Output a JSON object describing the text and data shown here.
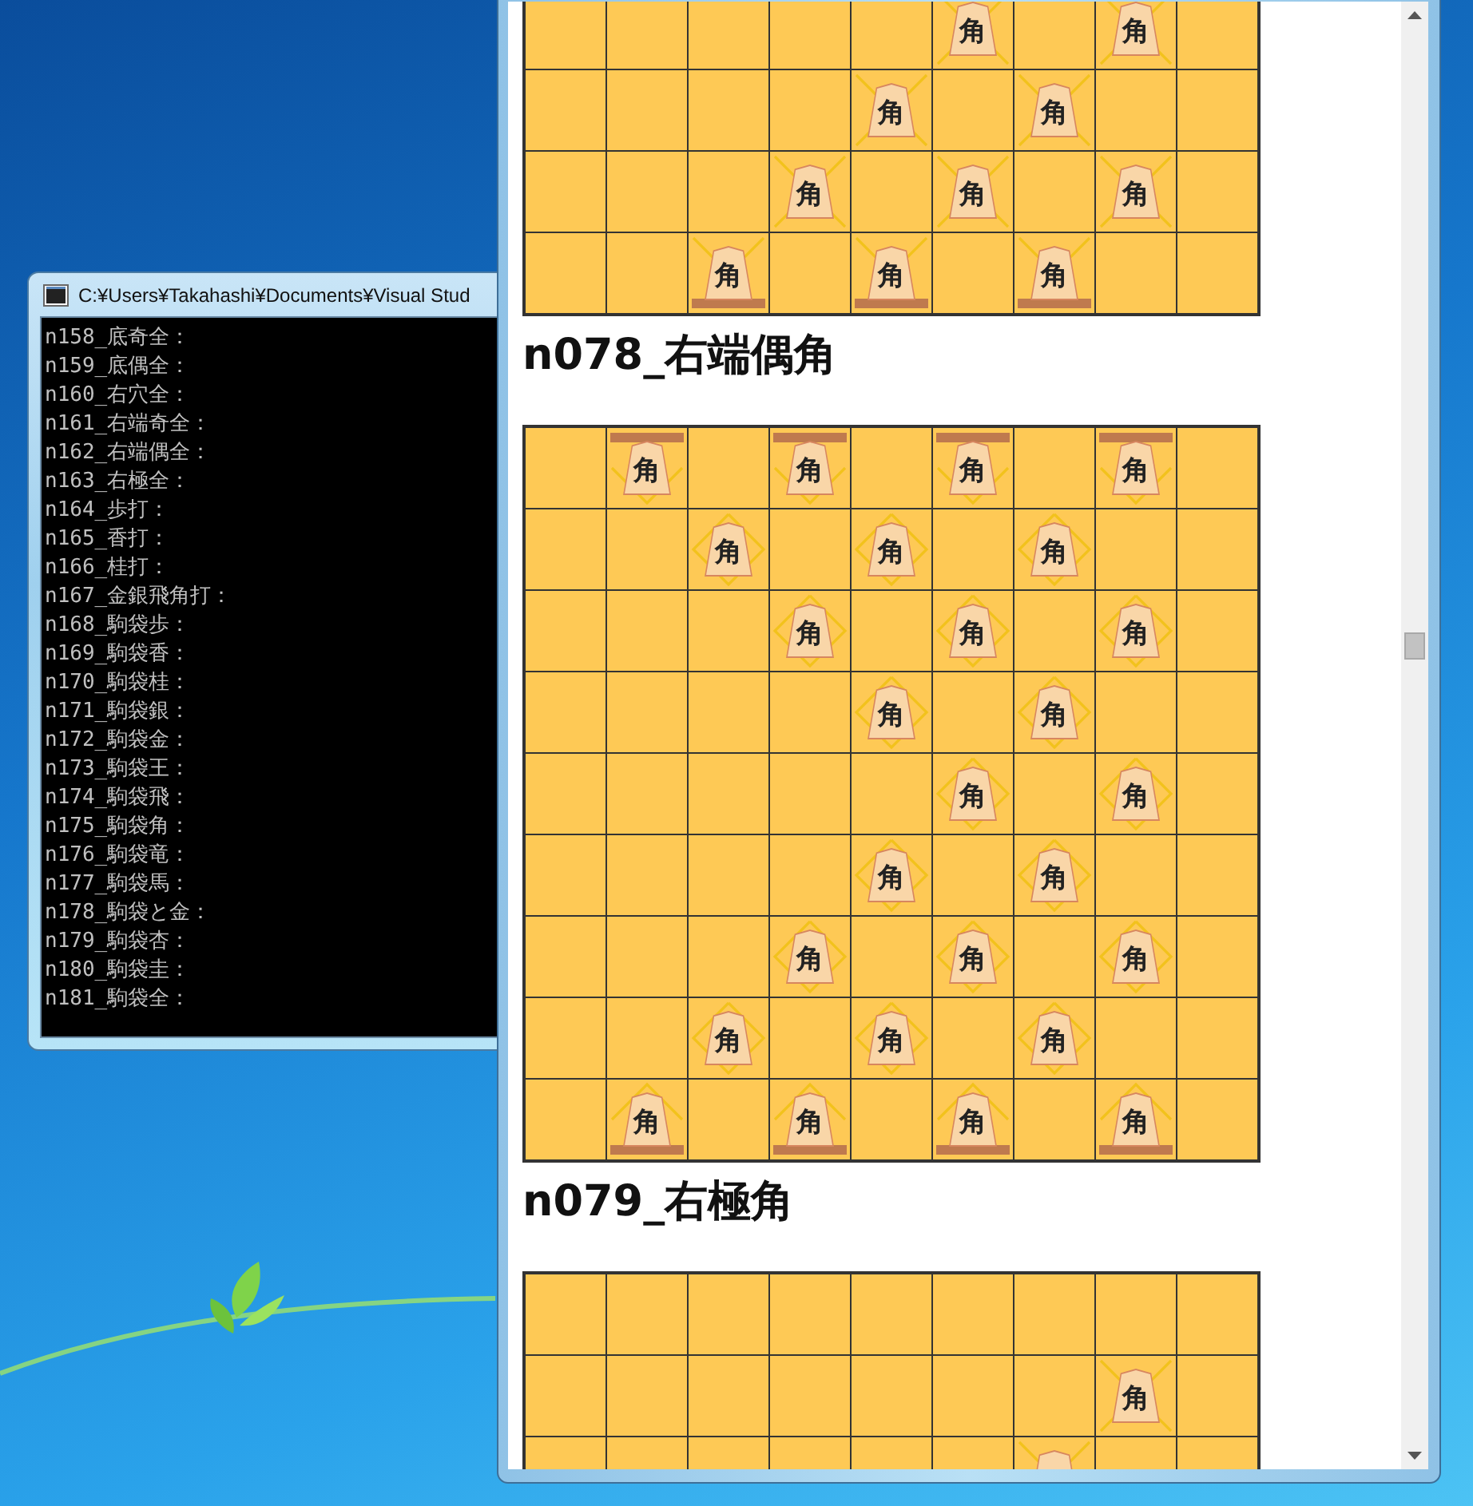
{
  "console_window": {
    "title": "C:¥Users¥Takahashi¥Documents¥Visual Stud",
    "lines": [
      "n158_底奇全：",
      "n159_底偶全：",
      "n160_右穴全：",
      "n161_右端奇全：",
      "n162_右端偶全：",
      "n163_右極全：",
      "n164_歩打：",
      "n165_香打：",
      "n166_桂打：",
      "n167_金銀飛角打：",
      "n168_駒袋歩：",
      "n169_駒袋香：",
      "n170_駒袋桂：",
      "n171_駒袋銀：",
      "n172_駒袋金：",
      "n173_駒袋王：",
      "n174_駒袋飛：",
      "n175_駒袋角：",
      "n176_駒袋竜：",
      "n177_駒袋馬：",
      "n178_駒袋と金：",
      "n179_駒袋杏：",
      "n180_駒袋圭：",
      "n181_駒袋全："
    ]
  },
  "document": {
    "sections": [
      {
        "board": {
          "rows": [
            [
              {},
              {},
              {},
              {},
              {},
              {
                "piece": "角",
                "diamond": false,
                "bar_top": false,
                "bar_bottom": false
              },
              {},
              {
                "piece": "角",
                "diamond": false,
                "bar_top": false,
                "bar_bottom": false
              },
              {}
            ],
            [
              {},
              {},
              {},
              {},
              {
                "piece": "角",
                "diamond": false,
                "bar_top": false,
                "bar_bottom": false
              },
              {},
              {
                "piece": "角",
                "diamond": false,
                "bar_top": false,
                "bar_bottom": false
              },
              {},
              {}
            ],
            [
              {},
              {},
              {},
              {
                "piece": "角",
                "diamond": false,
                "bar_top": false,
                "bar_bottom": false
              },
              {},
              {
                "piece": "角",
                "diamond": false,
                "bar_top": false,
                "bar_bottom": false
              },
              {},
              {
                "piece": "角",
                "diamond": false,
                "bar_top": false,
                "bar_bottom": false
              },
              {}
            ],
            [
              {},
              {},
              {
                "piece": "角",
                "diamond": false,
                "bar_top": false,
                "bar_bottom": true
              },
              {},
              {
                "piece": "角",
                "diamond": false,
                "bar_top": false,
                "bar_bottom": true
              },
              {},
              {
                "piece": "角",
                "diamond": false,
                "bar_top": false,
                "bar_bottom": true
              },
              {},
              {}
            ]
          ]
        }
      },
      {
        "heading": "n078_右端偶角",
        "board": {
          "rows": [
            [
              {},
              {
                "piece": "角",
                "diamond": true,
                "bar_top": true,
                "bar_bottom": false
              },
              {},
              {
                "piece": "角",
                "diamond": true,
                "bar_top": true,
                "bar_bottom": false
              },
              {},
              {
                "piece": "角",
                "diamond": true,
                "bar_top": true,
                "bar_bottom": false
              },
              {},
              {
                "piece": "角",
                "diamond": true,
                "bar_top": true,
                "bar_bottom": false
              },
              {}
            ],
            [
              {},
              {},
              {
                "piece": "角",
                "diamond": true,
                "bar_top": false,
                "bar_bottom": false
              },
              {},
              {
                "piece": "角",
                "diamond": true,
                "bar_top": false,
                "bar_bottom": false
              },
              {},
              {
                "piece": "角",
                "diamond": true,
                "bar_top": false,
                "bar_bottom": false
              },
              {},
              {}
            ],
            [
              {},
              {},
              {},
              {
                "piece": "角",
                "diamond": true,
                "bar_top": false,
                "bar_bottom": false
              },
              {},
              {
                "piece": "角",
                "diamond": true,
                "bar_top": false,
                "bar_bottom": false
              },
              {},
              {
                "piece": "角",
                "diamond": true,
                "bar_top": false,
                "bar_bottom": false
              },
              {}
            ],
            [
              {},
              {},
              {},
              {},
              {
                "piece": "角",
                "diamond": true,
                "bar_top": false,
                "bar_bottom": false
              },
              {},
              {
                "piece": "角",
                "diamond": true,
                "bar_top": false,
                "bar_bottom": false
              },
              {},
              {}
            ],
            [
              {},
              {},
              {},
              {},
              {},
              {
                "piece": "角",
                "diamond": true,
                "bar_top": false,
                "bar_bottom": false
              },
              {},
              {
                "piece": "角",
                "diamond": true,
                "bar_top": false,
                "bar_bottom": false
              },
              {}
            ],
            [
              {},
              {},
              {},
              {},
              {
                "piece": "角",
                "diamond": true,
                "bar_top": false,
                "bar_bottom": false
              },
              {},
              {
                "piece": "角",
                "diamond": true,
                "bar_top": false,
                "bar_bottom": false
              },
              {},
              {}
            ],
            [
              {},
              {},
              {},
              {
                "piece": "角",
                "diamond": true,
                "bar_top": false,
                "bar_bottom": false
              },
              {},
              {
                "piece": "角",
                "diamond": true,
                "bar_top": false,
                "bar_bottom": false
              },
              {},
              {
                "piece": "角",
                "diamond": true,
                "bar_top": false,
                "bar_bottom": false
              },
              {}
            ],
            [
              {},
              {},
              {
                "piece": "角",
                "diamond": true,
                "bar_top": false,
                "bar_bottom": false
              },
              {},
              {
                "piece": "角",
                "diamond": true,
                "bar_top": false,
                "bar_bottom": false
              },
              {},
              {
                "piece": "角",
                "diamond": true,
                "bar_top": false,
                "bar_bottom": false
              },
              {},
              {}
            ],
            [
              {},
              {
                "piece": "角",
                "diamond": true,
                "bar_top": false,
                "bar_bottom": true
              },
              {},
              {
                "piece": "角",
                "diamond": true,
                "bar_top": false,
                "bar_bottom": true
              },
              {},
              {
                "piece": "角",
                "diamond": true,
                "bar_top": false,
                "bar_bottom": true
              },
              {},
              {
                "piece": "角",
                "diamond": true,
                "bar_top": false,
                "bar_bottom": true
              },
              {}
            ]
          ]
        }
      },
      {
        "heading": "n079_右極角",
        "board": {
          "rows": [
            [
              {},
              {},
              {},
              {},
              {},
              {},
              {},
              {},
              {}
            ],
            [
              {},
              {},
              {},
              {},
              {},
              {},
              {},
              {
                "piece": "角",
                "diamond": false,
                "bar_top": false,
                "bar_bottom": false
              },
              {}
            ],
            [
              {},
              {},
              {},
              {},
              {},
              {},
              {
                "covered_piece": true,
                "diamond": false,
                "bar_top": false,
                "bar_bottom": false
              },
              {},
              {}
            ]
          ]
        }
      }
    ]
  }
}
